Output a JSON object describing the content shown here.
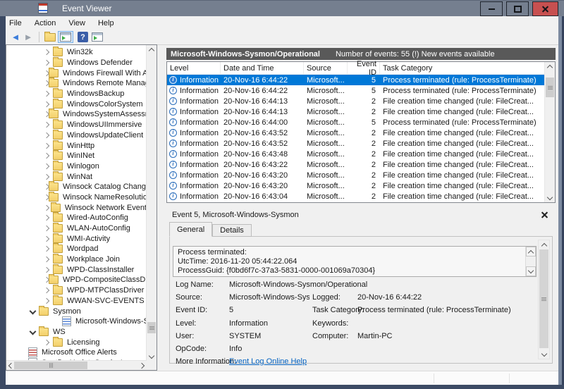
{
  "window": {
    "title": "Event Viewer"
  },
  "menu": {
    "items": [
      "File",
      "Action",
      "View",
      "Help"
    ]
  },
  "toolbar": {
    "icons": [
      "back-icon",
      "forward-icon",
      "open-saved-log-icon",
      "console-tree-toggle-icon",
      "help-icon",
      "action-pane-toggle-icon"
    ]
  },
  "tree": {
    "items": [
      {
        "label": "Win32k",
        "icon": "folder",
        "expander": "collapsed",
        "depth": 3
      },
      {
        "label": "Windows Defender",
        "icon": "folder",
        "expander": "collapsed",
        "depth": 3
      },
      {
        "label": "Windows Firewall With Adv",
        "icon": "folder",
        "expander": "collapsed",
        "depth": 3
      },
      {
        "label": "Windows Remote Manager",
        "icon": "folder",
        "expander": "collapsed",
        "depth": 3
      },
      {
        "label": "WindowsBackup",
        "icon": "folder",
        "expander": "collapsed",
        "depth": 3
      },
      {
        "label": "WindowsColorSystem",
        "icon": "folder",
        "expander": "collapsed",
        "depth": 3
      },
      {
        "label": "WindowsSystemAssessmen",
        "icon": "folder",
        "expander": "collapsed",
        "depth": 3
      },
      {
        "label": "WindowsUIImmersive",
        "icon": "folder",
        "expander": "collapsed",
        "depth": 3
      },
      {
        "label": "WindowsUpdateClient",
        "icon": "folder",
        "expander": "collapsed",
        "depth": 3
      },
      {
        "label": "WinHttp",
        "icon": "folder",
        "expander": "collapsed",
        "depth": 3
      },
      {
        "label": "WinINet",
        "icon": "folder",
        "expander": "collapsed",
        "depth": 3
      },
      {
        "label": "Winlogon",
        "icon": "folder",
        "expander": "collapsed",
        "depth": 3
      },
      {
        "label": "WinNat",
        "icon": "folder",
        "expander": "collapsed",
        "depth": 3
      },
      {
        "label": "Winsock Catalog Change",
        "icon": "folder",
        "expander": "collapsed",
        "depth": 3
      },
      {
        "label": "Winsock NameResolution E",
        "icon": "folder",
        "expander": "collapsed",
        "depth": 3
      },
      {
        "label": "Winsock Network Event",
        "icon": "folder",
        "expander": "collapsed",
        "depth": 3
      },
      {
        "label": "Wired-AutoConfig",
        "icon": "folder",
        "expander": "collapsed",
        "depth": 3
      },
      {
        "label": "WLAN-AutoConfig",
        "icon": "folder",
        "expander": "collapsed",
        "depth": 3
      },
      {
        "label": "WMI-Activity",
        "icon": "folder",
        "expander": "collapsed",
        "depth": 3
      },
      {
        "label": "Wordpad",
        "icon": "folder",
        "expander": "collapsed",
        "depth": 3
      },
      {
        "label": "Workplace Join",
        "icon": "folder",
        "expander": "collapsed",
        "depth": 3
      },
      {
        "label": "WPD-ClassInstaller",
        "icon": "folder",
        "expander": "collapsed",
        "depth": 3
      },
      {
        "label": "WPD-CompositeClassDrive",
        "icon": "folder",
        "expander": "collapsed",
        "depth": 3
      },
      {
        "label": "WPD-MTPClassDriver",
        "icon": "folder",
        "expander": "collapsed",
        "depth": 3
      },
      {
        "label": "WWAN-SVC-EVENTS",
        "icon": "folder",
        "expander": "collapsed",
        "depth": 3
      },
      {
        "label": "Sysmon",
        "icon": "folder",
        "expander": "expanded",
        "depth": 2
      },
      {
        "label": "Microsoft-Windows-Sys",
        "icon": "log-blue",
        "expander": "none",
        "depth": 4
      },
      {
        "label": "WS",
        "icon": "folder",
        "expander": "expanded",
        "depth": 2
      },
      {
        "label": "Licensing",
        "icon": "folder",
        "expander": "collapsed",
        "depth": 3
      },
      {
        "label": "Microsoft Office Alerts",
        "icon": "log-red",
        "expander": "none",
        "depth": 1
      },
      {
        "label": "SpotfluxUpdateServiceLog",
        "icon": "log-red",
        "expander": "none",
        "depth": 1
      }
    ]
  },
  "main": {
    "header": {
      "title": "Microsoft-Windows-Sysmon/Operational",
      "subtitle": "Number of events: 55 (!) New events available"
    },
    "table": {
      "columns": [
        "Level",
        "Date and Time",
        "Source",
        "Event ID",
        "Task Category"
      ],
      "rows": [
        {
          "level": "Information",
          "datetime": "20-Nov-16 6:44:22",
          "source": "Microsoft...",
          "event_id": "5",
          "task": "Process terminated (rule: ProcessTerminate)",
          "selected": true
        },
        {
          "level": "Information",
          "datetime": "20-Nov-16 6:44:22",
          "source": "Microsoft...",
          "event_id": "5",
          "task": "Process terminated (rule: ProcessTerminate)",
          "selected": false
        },
        {
          "level": "Information",
          "datetime": "20-Nov-16 6:44:13",
          "source": "Microsoft...",
          "event_id": "2",
          "task": "File creation time changed (rule: FileCreat...",
          "selected": false
        },
        {
          "level": "Information",
          "datetime": "20-Nov-16 6:44:13",
          "source": "Microsoft...",
          "event_id": "2",
          "task": "File creation time changed (rule: FileCreat...",
          "selected": false
        },
        {
          "level": "Information",
          "datetime": "20-Nov-16 6:44:00",
          "source": "Microsoft...",
          "event_id": "5",
          "task": "Process terminated (rule: ProcessTerminate)",
          "selected": false
        },
        {
          "level": "Information",
          "datetime": "20-Nov-16 6:43:52",
          "source": "Microsoft...",
          "event_id": "2",
          "task": "File creation time changed (rule: FileCreat...",
          "selected": false
        },
        {
          "level": "Information",
          "datetime": "20-Nov-16 6:43:52",
          "source": "Microsoft...",
          "event_id": "2",
          "task": "File creation time changed (rule: FileCreat...",
          "selected": false
        },
        {
          "level": "Information",
          "datetime": "20-Nov-16 6:43:48",
          "source": "Microsoft...",
          "event_id": "2",
          "task": "File creation time changed (rule: FileCreat...",
          "selected": false
        },
        {
          "level": "Information",
          "datetime": "20-Nov-16 6:43:22",
          "source": "Microsoft...",
          "event_id": "2",
          "task": "File creation time changed (rule: FileCreat...",
          "selected": false
        },
        {
          "level": "Information",
          "datetime": "20-Nov-16 6:43:20",
          "source": "Microsoft...",
          "event_id": "2",
          "task": "File creation time changed (rule: FileCreat...",
          "selected": false
        },
        {
          "level": "Information",
          "datetime": "20-Nov-16 6:43:20",
          "source": "Microsoft...",
          "event_id": "2",
          "task": "File creation time changed (rule: FileCreat...",
          "selected": false
        },
        {
          "level": "Information",
          "datetime": "20-Nov-16 6:43:04",
          "source": "Microsoft...",
          "event_id": "2",
          "task": "File creation time changed (rule: FileCreat...",
          "selected": false
        }
      ]
    },
    "detail": {
      "title": "Event 5, Microsoft-Windows-Sysmon",
      "tabs": [
        "General",
        "Details"
      ],
      "active_tab": "General",
      "message_lines": [
        "Process terminated:",
        "UtcTime: 2016-11-20 05:44:22.064",
        "ProcessGuid: {f0bd6f7c-37a3-5831-0000-001069a70304}"
      ],
      "fields": {
        "log_name_label": "Log Name:",
        "log_name": "Microsoft-Windows-Sysmon/Operational",
        "source_label": "Source:",
        "source": "Microsoft-Windows-Sysmon",
        "event_id_label": "Event ID:",
        "event_id": "5",
        "level_label": "Level:",
        "level": "Information",
        "user_label": "User:",
        "user": "SYSTEM",
        "opcode_label": "OpCode:",
        "opcode": "Info",
        "logged_label": "Logged:",
        "logged": "20-Nov-16 6:44:22",
        "task_label": "Task Category:",
        "task": "Process terminated (rule: ProcessTerminate)",
        "keywords_label": "Keywords:",
        "keywords": "",
        "computer_label": "Computer:",
        "computer": "Martin-PC",
        "more_info_label": "More Information:",
        "more_info_link": "Event Log Online Help"
      }
    }
  },
  "colors": {
    "titlebar": "#757f8f",
    "close_button": "#c75050",
    "header_bar": "#595959",
    "selection": "#0078d7",
    "info_icon": "#2a6dbb",
    "link": "#0563c1",
    "folder": "#f3cf6b",
    "frame": "#3c4a64"
  }
}
